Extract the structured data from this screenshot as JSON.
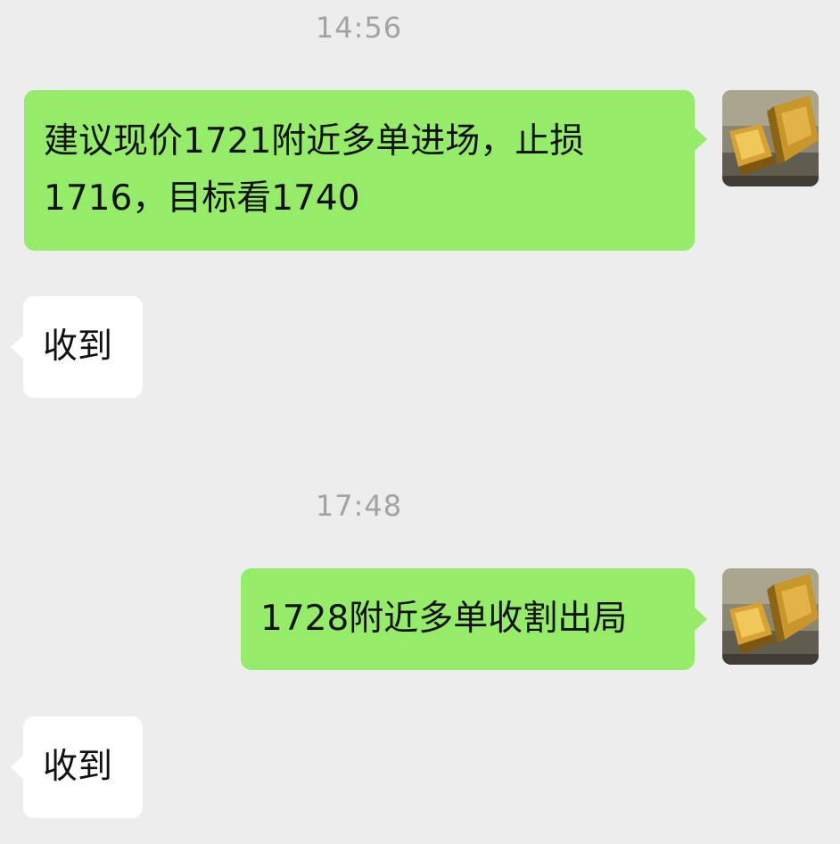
{
  "chat": {
    "messages": [
      {
        "type": "timestamp",
        "text": "14:56"
      },
      {
        "type": "sent",
        "text": "建议现价1721附近多单进场，止损1716，目标看1740",
        "lines": [
          "建议现价1721附近多单进场，止损",
          "1716，目标看1740"
        ],
        "avatar": "gold-bars-avatar"
      },
      {
        "type": "received",
        "text": "收到"
      },
      {
        "type": "timestamp",
        "text": "17:48"
      },
      {
        "type": "sent",
        "text": "1728附近多单收割出局",
        "avatar": "gold-bars-avatar"
      },
      {
        "type": "received",
        "text": "收到"
      }
    ]
  },
  "colors": {
    "background": "#ededed",
    "sent_bubble": "#95ec69",
    "received_bubble": "#ffffff",
    "timestamp_text": "#a3a3a3",
    "message_text": "#111111"
  }
}
